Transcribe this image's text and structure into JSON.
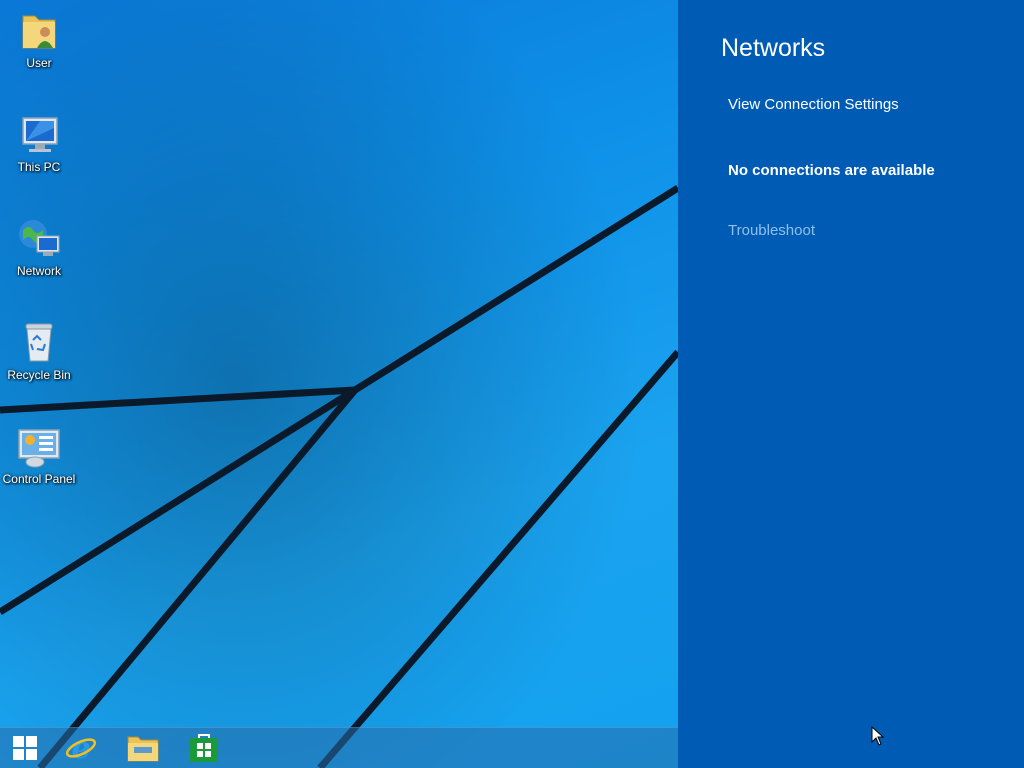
{
  "desktop": {
    "icons": [
      {
        "label": "User",
        "icon": "user-folder-icon"
      },
      {
        "label": "This PC",
        "icon": "this-pc-icon"
      },
      {
        "label": "Network",
        "icon": "network-icon"
      },
      {
        "label": "Recycle Bin",
        "icon": "recycle-bin-icon"
      },
      {
        "label": "Control Panel",
        "icon": "control-panel-icon"
      }
    ]
  },
  "taskbar": {
    "items": [
      {
        "icon": "windows-start-icon"
      },
      {
        "icon": "internet-explorer-icon"
      },
      {
        "icon": "file-explorer-icon"
      },
      {
        "icon": "store-icon"
      }
    ]
  },
  "networks_panel": {
    "title": "Networks",
    "view_settings_link": "View Connection Settings",
    "status": "No connections are available",
    "troubleshoot_link": "Troubleshoot"
  },
  "colors": {
    "panel_background": "#005bb5",
    "desktop_background": "#0e90e8",
    "troubleshoot_link": "#8fc0ea"
  }
}
